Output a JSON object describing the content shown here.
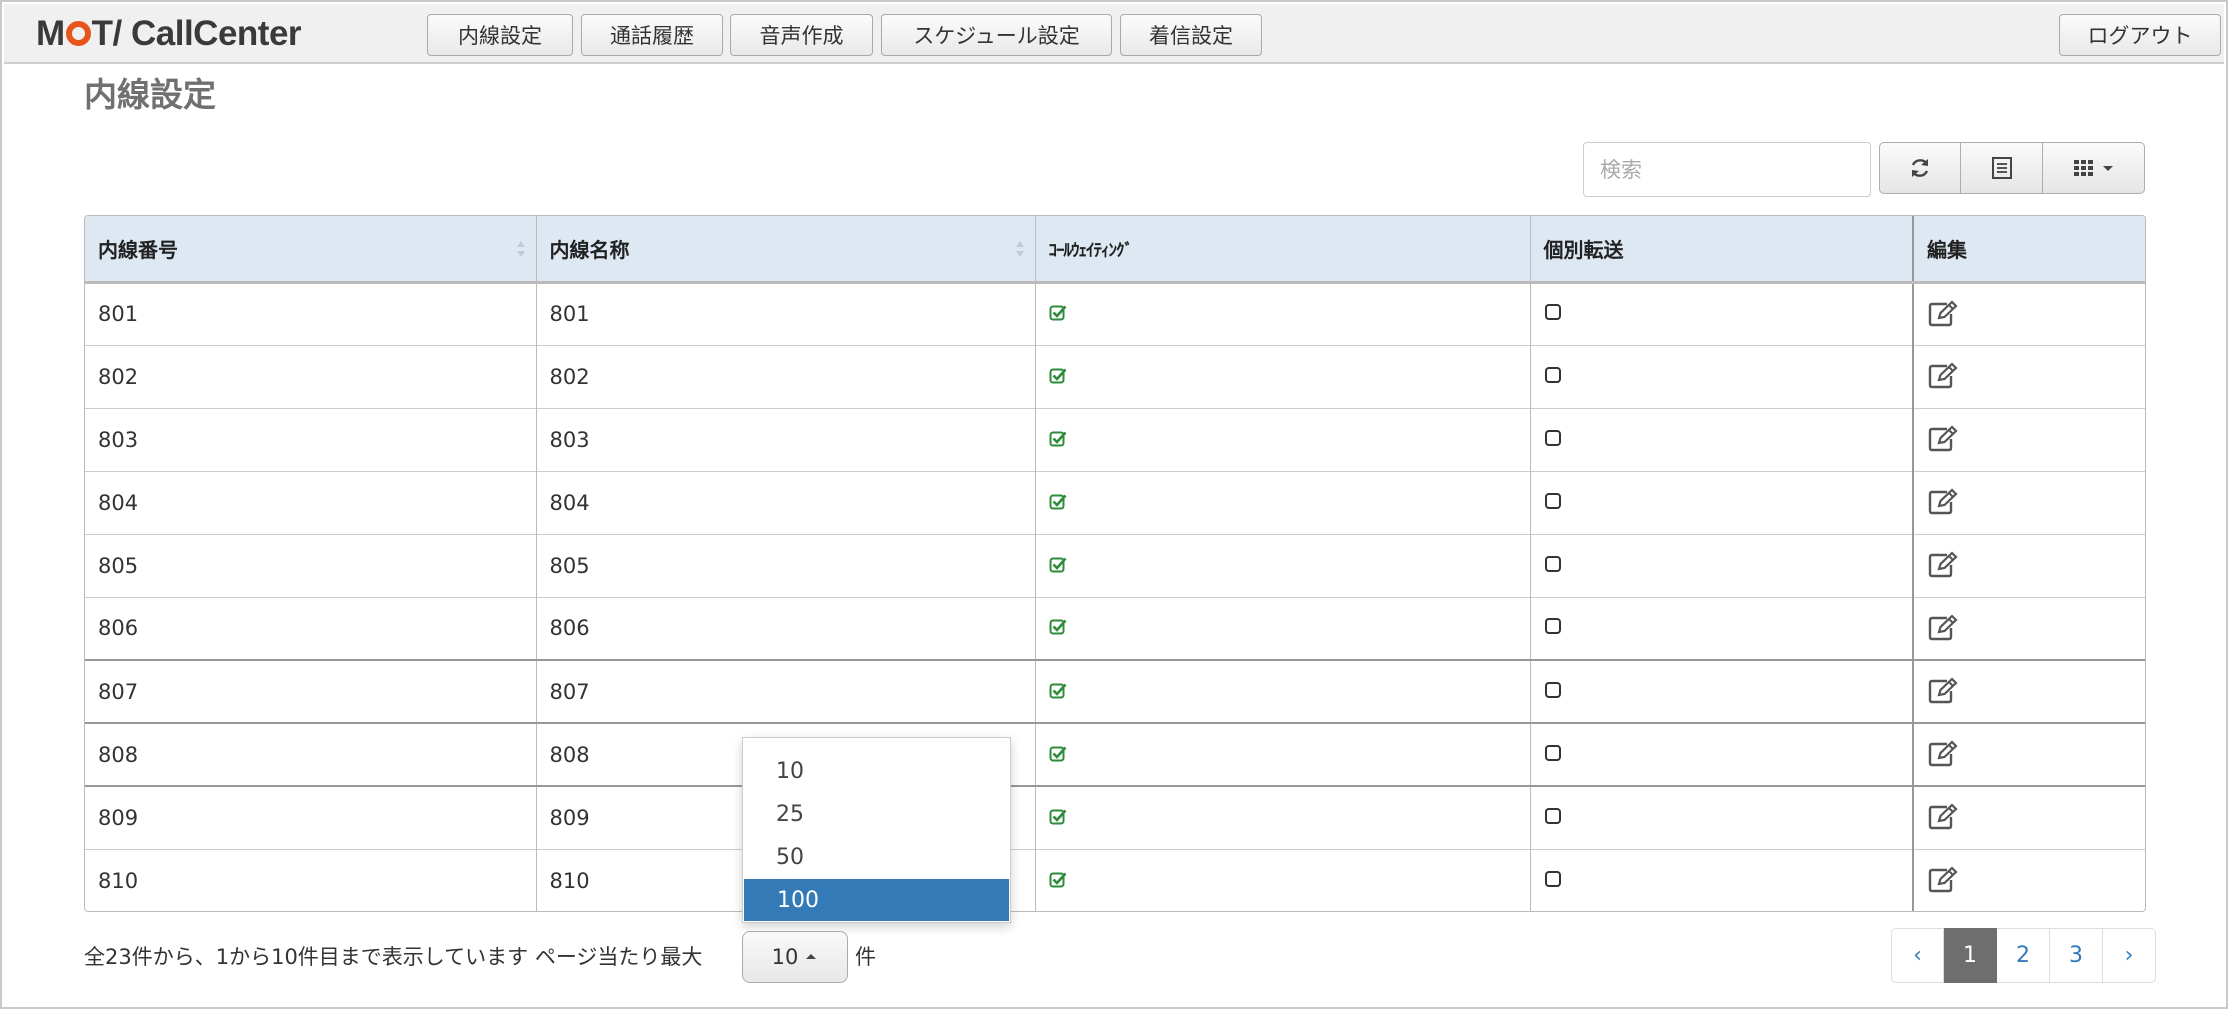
{
  "app": {
    "logo_mo": "M",
    "logo_rest": "T/ CallCenter"
  },
  "nav": {
    "items": [
      "内線設定",
      "通話履歴",
      "音声作成",
      "スケジュール設定",
      "着信設定"
    ],
    "logout": "ログアウト"
  },
  "page": {
    "title": "内線設定"
  },
  "toolbar": {
    "search_placeholder": "検索",
    "refresh_icon": "refresh-icon",
    "list_icon": "list-icon",
    "columns_icon": "grid-icon"
  },
  "table": {
    "headers": [
      "内線番号",
      "内線名称",
      "ｺｰﾙｳｪｲﾃｨﾝｸﾞ",
      "個別転送",
      "編集"
    ],
    "rows": [
      {
        "number": "801",
        "name": "801",
        "call_waiting": true,
        "individual_transfer": false
      },
      {
        "number": "802",
        "name": "802",
        "call_waiting": true,
        "individual_transfer": false
      },
      {
        "number": "803",
        "name": "803",
        "call_waiting": true,
        "individual_transfer": false
      },
      {
        "number": "804",
        "name": "804",
        "call_waiting": true,
        "individual_transfer": false
      },
      {
        "number": "805",
        "name": "805",
        "call_waiting": true,
        "individual_transfer": false
      },
      {
        "number": "806",
        "name": "806",
        "call_waiting": true,
        "individual_transfer": false
      },
      {
        "number": "807",
        "name": "807",
        "call_waiting": true,
        "individual_transfer": false
      },
      {
        "number": "808",
        "name": "808",
        "call_waiting": true,
        "individual_transfer": false
      },
      {
        "number": "809",
        "name": "809",
        "call_waiting": true,
        "individual_transfer": false
      },
      {
        "number": "810",
        "name": "810",
        "call_waiting": true,
        "individual_transfer": false
      }
    ]
  },
  "page_size_dropdown": {
    "options": [
      "10",
      "25",
      "50",
      "100"
    ],
    "highlighted": "100"
  },
  "footer": {
    "info": "全23件から、1から10件目まで表示しています ページ当たり最大",
    "page_size": "10",
    "unit": "件"
  },
  "pagination": {
    "prev": "‹",
    "pages": [
      "1",
      "2",
      "3"
    ],
    "current": "1",
    "next": "›"
  },
  "colors": {
    "accent": "#337ab7",
    "check_green": "#2e8b3a",
    "header_bg": "#dde8f3",
    "logo_orange": "#e8551a"
  }
}
